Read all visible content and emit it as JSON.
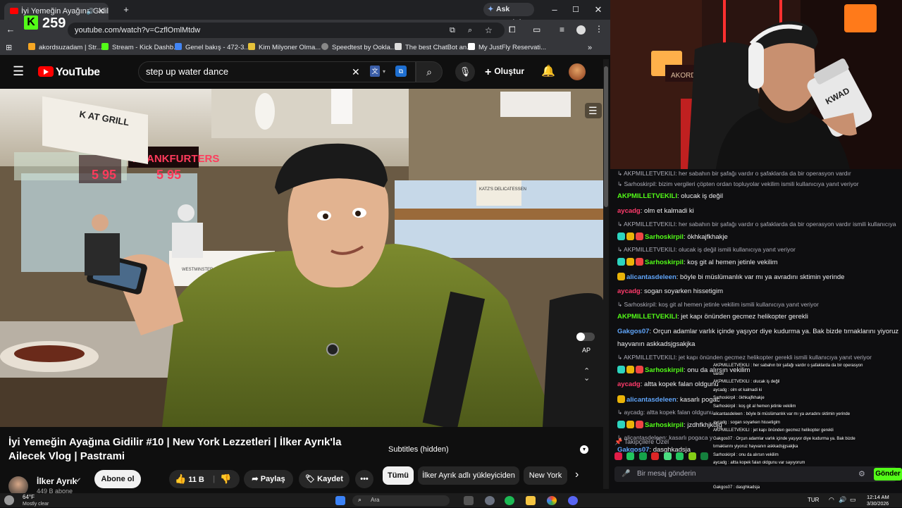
{
  "browser": {
    "tab_title": "İyi Yemeğin Ayağına Gidilir",
    "ask_gemini": "Ask Gemini",
    "url": "youtube.com/watch?v=CzflOmlMtdw",
    "kick_viewers": "259",
    "bookmarks": [
      "akordsuzadam | Str...",
      "Stream - Kick Dashb...",
      "Genel bakış - 472-3...",
      "Kim Milyoner Olma...",
      "Speedtest by Ookla...",
      "The best ChatBot an...",
      "My JustFly Reservati..."
    ]
  },
  "youtube": {
    "logo": "YouTube",
    "search_value": "step up water dance",
    "create_label": "Oluştur",
    "video_title": "İyi Yemeğin Ayağına Gidilir #10 | New York Lezzetleri | İlker Ayrık'la Ailecek Vlog | Pastrami",
    "subtitles": "Subtitles (hidden)",
    "channel_name": "İlker Ayrık",
    "subscribers": "449 B abone",
    "subscribe_label": "Abone ol",
    "likes": "11 B",
    "share_label": "Paylaş",
    "save_label": "Kaydet",
    "chips": [
      "Tümü",
      "İlker Ayrık adlı yükleyiciden",
      "New York"
    ],
    "video_signs": {
      "grill": "K AT GRILL",
      "frankfurters": "FRANKFURTERS",
      "price1": "5 95",
      "price2": "5 95",
      "katzs": "KATZ'S DELICATESSEN",
      "bakers": "WESTMINSTER BAKERS CO",
      "ap": "AP"
    }
  },
  "stream": {
    "chat_messages": [
      {
        "type": "sys",
        "text": "AKPMILLETVEKILI: her sabahın bir şafağı vardır o şafaklarda da bir operasyon vardır"
      },
      {
        "type": "sys",
        "text": "Sarhoskirpil: bizim vergileri çöpten ordan topluyolar vekilim ismili kullanıcıya yanıt veriyor"
      },
      {
        "type": "msg",
        "user": "AKPMILLETVEKILI",
        "color": "#53fc18",
        "badges": [],
        "text": "olucak iş değil"
      },
      {
        "type": "msg",
        "user": "aycadg",
        "color": "#ff3b6b",
        "badges": [],
        "text": "olm et kalmadi ki"
      },
      {
        "type": "sys",
        "text": "AKPMILLETVEKILI: her sabahın bir şafağı vardır o şafaklarda da bir operasyon vardır ismili kullanıcıya"
      },
      {
        "type": "msg",
        "user": "Sarhoskirpil",
        "color": "#53fc18",
        "badges": [
          "#2dd4bf",
          "#eab308",
          "#ef4444"
        ],
        "text": "ökhkajfkhakje"
      },
      {
        "type": "sys",
        "text": "AKPMILLETVEKILI: olucak iş değil ismili kullanıcıya yanıt veriyor"
      },
      {
        "type": "msg",
        "user": "Sarhoskirpil",
        "color": "#53fc18",
        "badges": [
          "#2dd4bf",
          "#eab308",
          "#ef4444"
        ],
        "text": "koş git al hemen jetinle vekilim"
      },
      {
        "type": "msg",
        "user": "alicantasdeleen",
        "color": "#60a5fa",
        "badges": [
          "#eab308"
        ],
        "text": "böyle bi müslümanlık var mı ya avradını sktimin yerinde"
      },
      {
        "type": "msg",
        "user": "aycadg",
        "color": "#ff3b6b",
        "badges": [],
        "text": "sogan soyarken hissetigim"
      },
      {
        "type": "sys",
        "text": "Sarhoskirpil: koş git al hemen jetinle vekilim ismili kullanıcıya yanıt veriyor"
      },
      {
        "type": "msg",
        "user": "AKPMILLETVEKILI",
        "color": "#53fc18",
        "badges": [],
        "text": "jet kapı önünden gecmez helikopter gerekli"
      },
      {
        "type": "msg",
        "user": "Gakgos07",
        "color": "#60a5fa",
        "badges": [],
        "text": "Orçun adamlar varlık içinde yaşıyor diye kudurma ya. Bak bizde tırnaklarını yiyoruz"
      },
      {
        "type": "cont",
        "text": "hayvanın askkadsjgsakjka"
      },
      {
        "type": "sys",
        "text": "AKPMILLETVEKILI: jet kapı önünden gecmez helikopter gerekli ismili kullanıcıya yanıt veriyor"
      },
      {
        "type": "msg",
        "user": "Sarhoskirpil",
        "color": "#53fc18",
        "badges": [
          "#2dd4bf",
          "#eab308",
          "#ef4444"
        ],
        "text": "onu da alırsın vekilim"
      },
      {
        "type": "msg",
        "user": "aycadg",
        "color": "#ff3b6b",
        "badges": [],
        "text": "altta kopek falan oldgunu"
      },
      {
        "type": "msg",
        "user": "alicantasdeleen",
        "color": "#60a5fa",
        "badges": [
          "#eab308"
        ],
        "text": "kasarlı pogac"
      },
      {
        "type": "sys",
        "text": "aycadg: altta kopek falan oldgunu"
      },
      {
        "type": "msg",
        "user": "Sarhoskirpil",
        "color": "#53fc18",
        "badges": [
          "#2dd4bf",
          "#eab308",
          "#ef4444"
        ],
        "text": "jzdhfkhjkdjg"
      },
      {
        "type": "sys",
        "text": "alicantasdeleen: kasarlı pogaca y"
      },
      {
        "type": "msg",
        "user": "Gakgos07",
        "color": "#60a5fa",
        "badges": [],
        "text": "dasghkadsja"
      }
    ],
    "overlay_messages": [
      "AKPMILLETVEKILI : her sabahın bir şafağı vardır o şafaklarda da bir operasyon",
      "vardır",
      "AKPMILLETVEKILI : olucak iş değil",
      "aycadg : olm et kalmadi ki",
      "Sarhoskirpil : ökhkajfkhakje",
      "Sarhoskirpil : koş git al hemen jetinle vekilim",
      "alicantasdeleen : böyle bi müslümanlık var mı ya avradını sktimin yerinde",
      "aycadg : sogan soyarken hissetigim",
      "AKPMILLETVEKILI : jet kapı önünden gecmez helikopter gerekli",
      "Gakgos07 : Orçun adamlar varlık içinde yaşıyor diye kudurma ya. Bak bizde",
      "tırnaklarını yiyoruz hayvanın askkadsjgsakjka",
      "Sarhoskirpil : onu da alırsın vekilim",
      "aycadg : altta kopek falan oldgunu var sayıyorum",
      "alicantasdeleen : kasarlı pogaca yiyom saç cogaa yeter artık",
      "Sarhoskirpil : jzdhfkhjkdjg",
      "Gakgos07 : dasghkadsja"
    ],
    "followers_label": "Takipçilere Özel",
    "chat_placeholder": "Bir mesaj gönderin",
    "send_label": "Gönder",
    "cam_sign": "AKORDSZ",
    "cup_text": "KWAD"
  },
  "taskbar": {
    "weather_temp": "64°F",
    "weather_desc": "Mostly clear",
    "search_label": "Ara",
    "lang": "TUR",
    "time": "12:14 AM",
    "date": "3/30/2026"
  }
}
